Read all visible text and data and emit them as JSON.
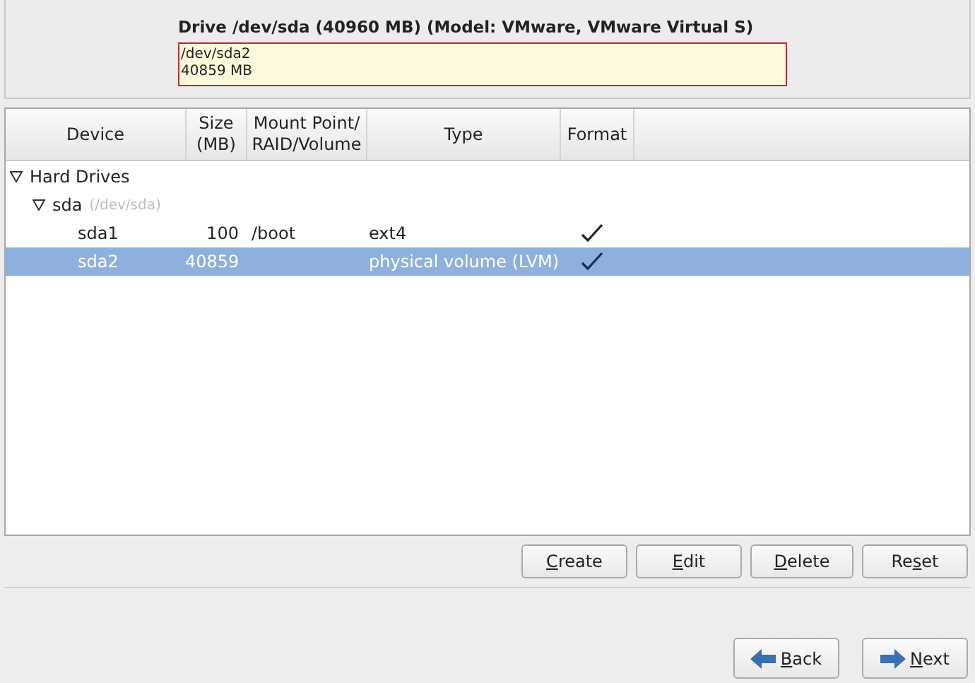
{
  "drive": {
    "title": "Drive /dev/sda (40960 MB) (Model: VMware, VMware Virtual S)",
    "partition": {
      "device": "/dev/sda2",
      "size": "40859 MB"
    }
  },
  "table": {
    "columns": [
      {
        "label": "Device"
      },
      {
        "label": "Size (MB)"
      },
      {
        "label": "Mount Point/ RAID/Volume"
      },
      {
        "label": "Type"
      },
      {
        "label": "Format"
      }
    ],
    "tree": [
      {
        "name": "Hard Drives",
        "expanded": true,
        "children": [
          {
            "name": "sda",
            "path": "(/dev/sda)",
            "expanded": true,
            "children": [
              {
                "name": "sda1",
                "size": "100",
                "mount": "/boot",
                "type": "ext4",
                "format": true,
                "selected": false
              },
              {
                "name": "sda2",
                "size": "40859",
                "type": "physical volume (LVM)",
                "format": true,
                "selected": true
              }
            ]
          }
        ]
      }
    ]
  },
  "actions": [
    {
      "key": "C",
      "post": "reate"
    },
    {
      "key": "E",
      "post": "dit"
    },
    {
      "key": "D",
      "post": "elete"
    },
    {
      "pre": "Re",
      "key": "s",
      "post": "et"
    }
  ],
  "nav": [
    {
      "kind": "back",
      "key": "B",
      "post": "ack"
    },
    {
      "kind": "next",
      "key": "N",
      "post": "ext"
    }
  ]
}
